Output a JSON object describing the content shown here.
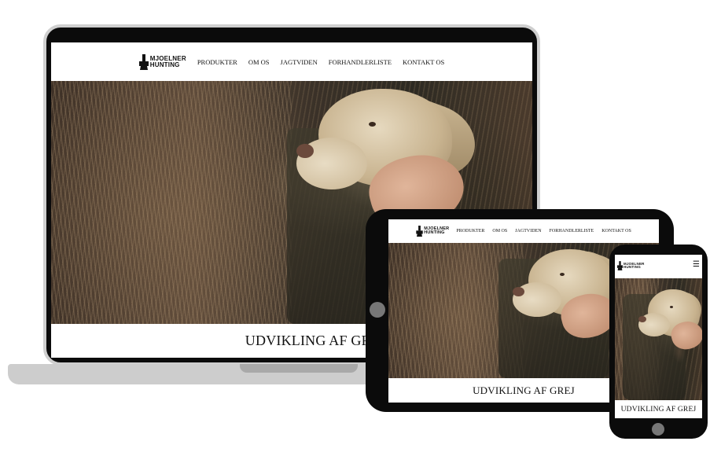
{
  "brand": {
    "line1": "MJOELNER",
    "line2": "HUNTING"
  },
  "nav": [
    "PRODUKTER",
    "OM OS",
    "JAGTVIDEN",
    "FORHANDLERLISTE",
    "KONTAKT OS"
  ],
  "hero": {
    "heading": "UDVIKLING AF GREJ"
  },
  "icons": {
    "logo": "hammer-logo-icon",
    "menu": "hamburger-menu-icon"
  },
  "glyphs": {
    "menu": "☰"
  },
  "colors": {
    "device_frame": "#0b0b0b",
    "laptop_bezel": "#cfcfcf",
    "text": "#111111"
  }
}
